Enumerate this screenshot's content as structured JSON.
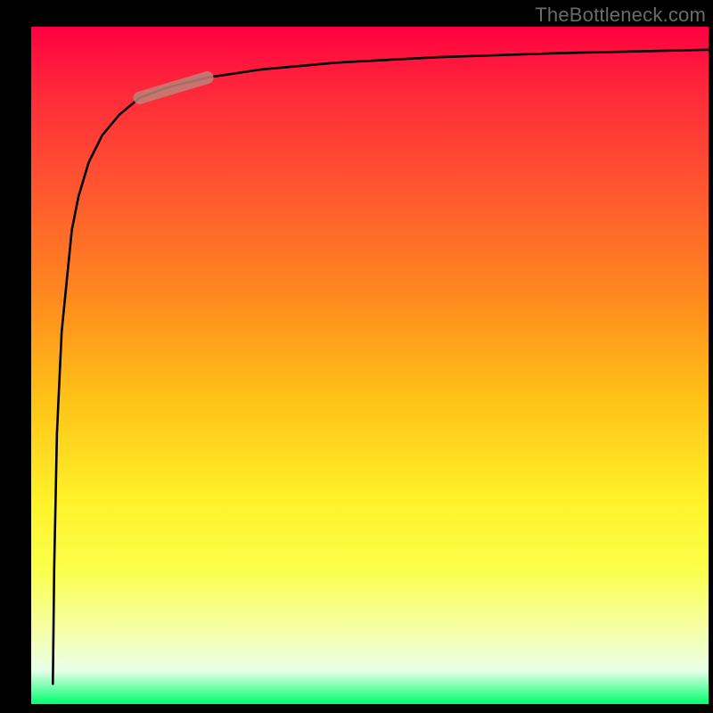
{
  "watermark": "TheBottleneck.com",
  "colors": {
    "background": "#000000",
    "curve": "#000000",
    "highlight": "#be8278",
    "gradient_top": "#ff0040",
    "gradient_bottom": "#00ff70"
  },
  "chart_data": {
    "type": "line",
    "title": "",
    "xlabel": "",
    "ylabel": "",
    "xlim": [
      0,
      100
    ],
    "ylim": [
      100,
      0
    ],
    "grid": false,
    "legend": false,
    "series": [
      {
        "name": "curve",
        "x": [
          3.2,
          3.4,
          3.8,
          4.5,
          5.5,
          6.0,
          7.0,
          8.5,
          10.5,
          13.0,
          16.0,
          20.0,
          26.0,
          34.0,
          45.0,
          60.0,
          78.0,
          100.0
        ],
        "values": [
          97.0,
          80.0,
          60.0,
          45.0,
          35.0,
          30.0,
          25.0,
          20.0,
          16.0,
          13.0,
          10.5,
          9.0,
          7.5,
          6.3,
          5.3,
          4.5,
          3.9,
          3.4
        ]
      }
    ],
    "highlight_segment": {
      "x": [
        16.0,
        26.0
      ],
      "values": [
        10.5,
        7.5
      ]
    }
  }
}
